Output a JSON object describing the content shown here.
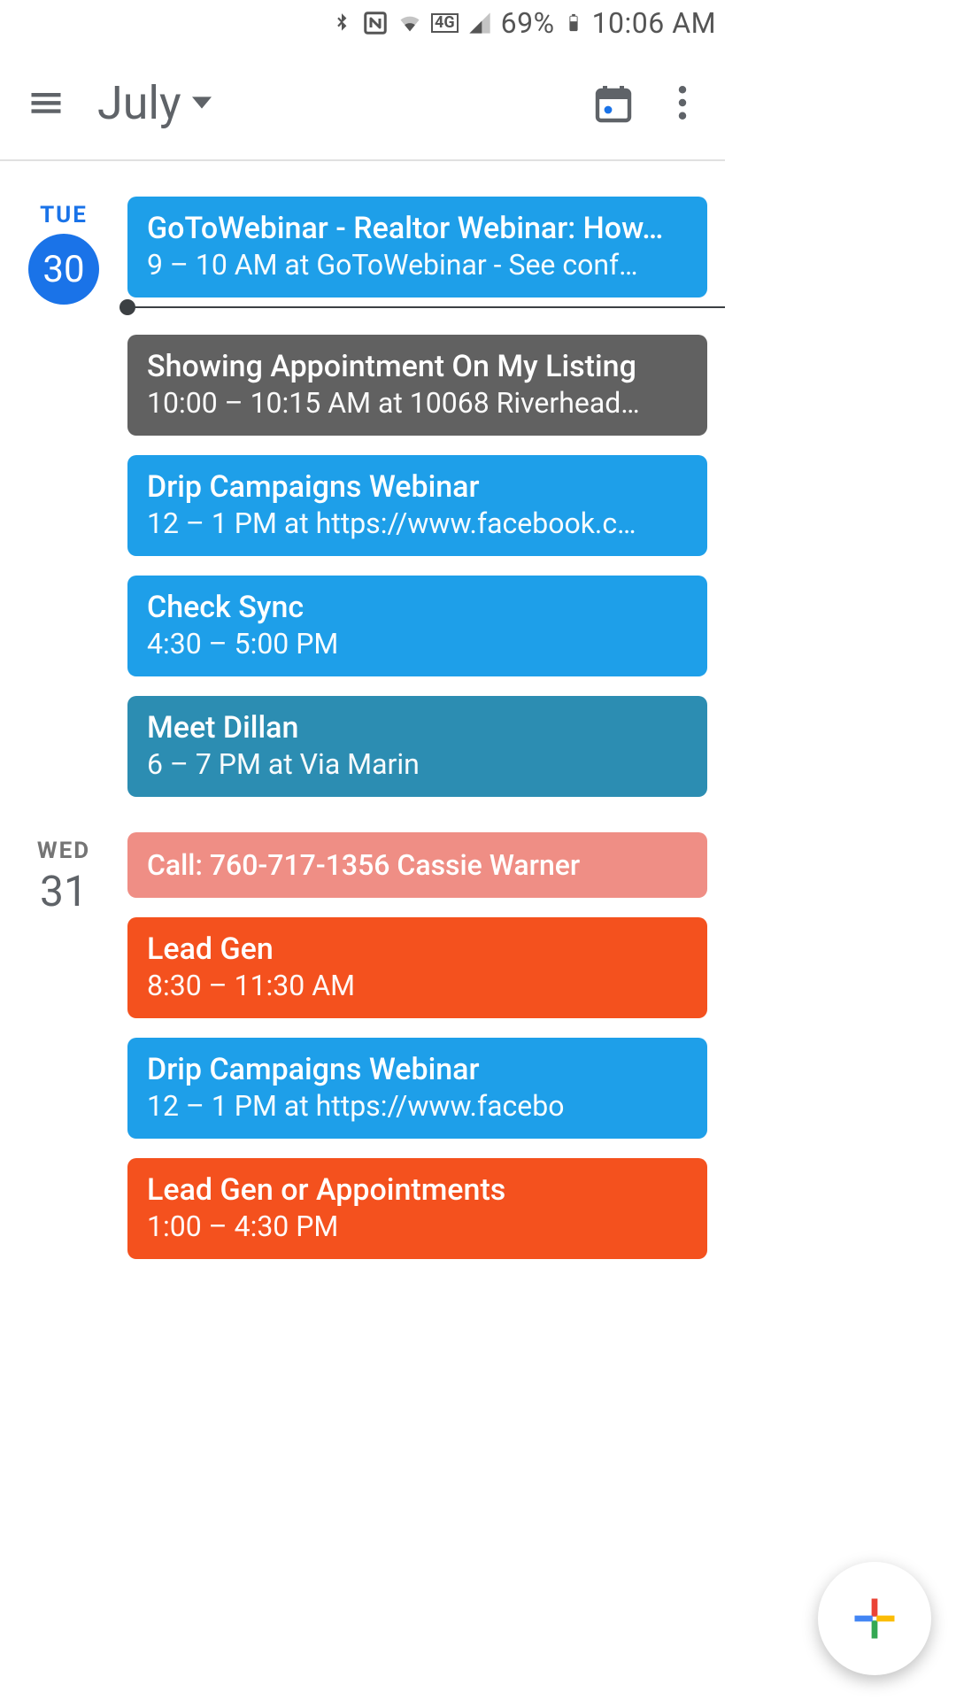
{
  "status": {
    "battery_pct": "69%",
    "clock": "10:06 AM",
    "network_label": "4G"
  },
  "header": {
    "month_label": "July"
  },
  "colors": {
    "blue": "#1e9fe9",
    "grey": "#616161",
    "teal": "#2c8db2",
    "salmon": "#ef8e85",
    "orange": "#f4511e",
    "today_accent": "#1a73e8"
  },
  "days": [
    {
      "dow": "TUE",
      "dom": "30",
      "is_today": true,
      "events": [
        {
          "title": "GoToWebinar - Realtor Webinar: How…",
          "subtitle": "9 – 10 AM at GoToWebinar - See conf…",
          "color": "blue"
        },
        {
          "title": "Showing Appointment On My Listing",
          "subtitle": "10:00 – 10:15 AM at 10068 Riverhead…",
          "color": "grey"
        },
        {
          "title": "Drip Campaigns Webinar",
          "subtitle": "12 – 1 PM at https://www.facebook.c…",
          "color": "blue"
        },
        {
          "title": "Check Sync",
          "subtitle": "4:30 – 5:00 PM",
          "color": "blue"
        },
        {
          "title": "Meet Dillan",
          "subtitle": "6 – 7 PM at Via Marin",
          "color": "teal"
        }
      ]
    },
    {
      "dow": "WED",
      "dom": "31",
      "is_today": false,
      "events": [
        {
          "title": "Call: 760-717-1356 Cassie Warner",
          "subtitle": "",
          "color": "salmon"
        },
        {
          "title": "Lead Gen",
          "subtitle": "8:30 – 11:30 AM",
          "color": "orange"
        },
        {
          "title": "Drip Campaigns Webinar",
          "subtitle": "12 – 1 PM at https://www.facebo",
          "color": "blue"
        },
        {
          "title": "Lead Gen or Appointments",
          "subtitle": "1:00 – 4:30 PM",
          "color": "orange"
        }
      ]
    }
  ]
}
